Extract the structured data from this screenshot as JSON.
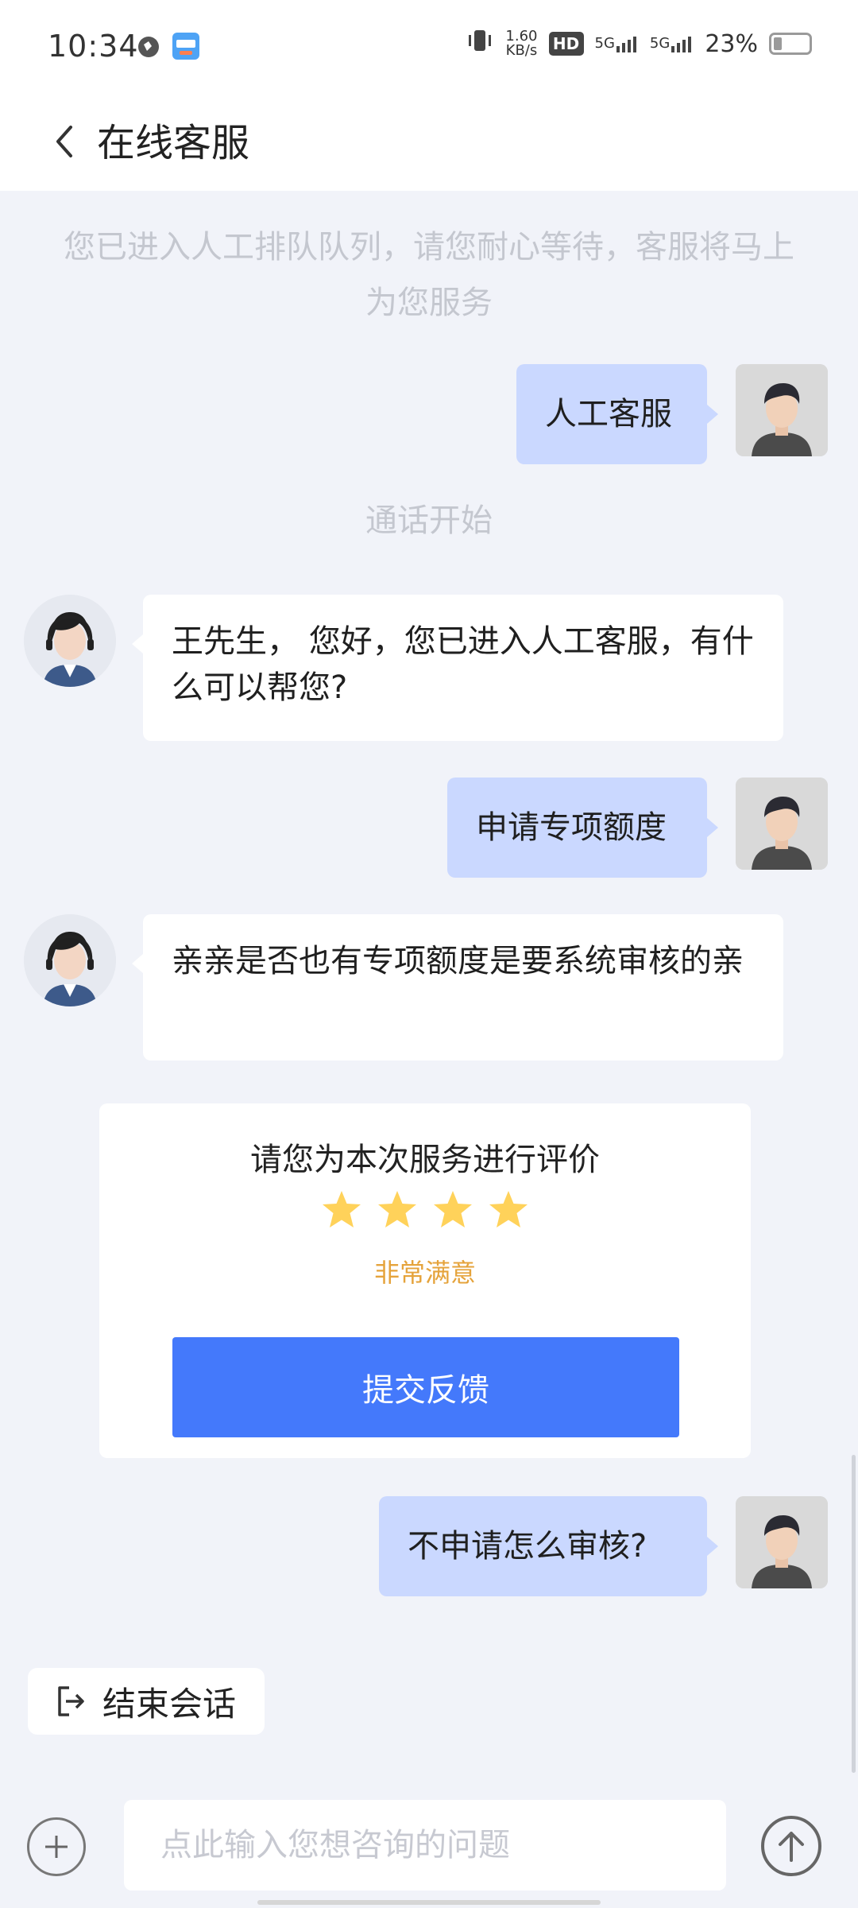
{
  "status_bar": {
    "time": "10:34",
    "net_speed_value": "1.60",
    "net_speed_unit": "KB/s",
    "hd_label": "HD",
    "signal1": "5G",
    "signal2": "5G",
    "battery": "23%"
  },
  "header": {
    "title": "在线客服"
  },
  "messages": {
    "queue_notice": "您已进入人工排队队列，请您耐心等待，客服将马上为您服务",
    "user_1": "人工客服",
    "call_start": "通话开始",
    "agent_1": "王先生， 您好，您已进入人工客服，有什么可以帮您?",
    "user_2": "申请专项额度",
    "agent_2": "亲亲是否也有专项额度是要系统审核的亲",
    "user_3": "不申请怎么审核?"
  },
  "rating": {
    "title": "请您为本次服务进行评价",
    "stars_filled": 4,
    "result": "非常满意",
    "submit_label": "提交反馈",
    "star_color": "#ffd25a"
  },
  "end_session": {
    "label": "结束会话"
  },
  "input": {
    "placeholder": "点此输入您想咨询的问题"
  },
  "colors": {
    "user_bubble": "#cad8ff",
    "primary_button": "#4479fb",
    "rating_result": "#e5a33b"
  }
}
